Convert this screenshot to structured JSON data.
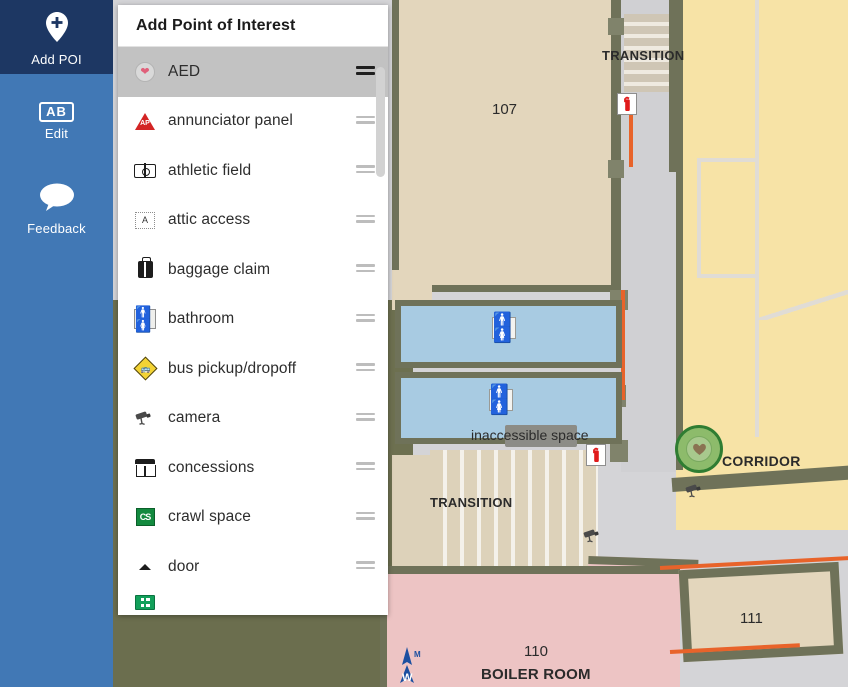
{
  "sidebar": {
    "items": [
      {
        "id": "add-poi",
        "label": "Add POI",
        "icon": "map-pin-plus-icon",
        "active": true
      },
      {
        "id": "edit",
        "label": "Edit",
        "icon": "ab-box-icon",
        "active": false
      },
      {
        "id": "feedback",
        "label": "Feedback",
        "icon": "speech-bubble-icon",
        "active": false
      }
    ],
    "active_color": "#1d3763",
    "background_color": "#4178b5"
  },
  "panel": {
    "title": "Add Point of Interest",
    "items": [
      {
        "label": "AED",
        "icon": "aed-heart-icon",
        "selected": true
      },
      {
        "label": "annunciator panel",
        "icon": "annunciator-panel-icon",
        "selected": false
      },
      {
        "label": "athletic field",
        "icon": "athletic-field-icon",
        "selected": false
      },
      {
        "label": "attic access",
        "icon": "attic-access-icon",
        "selected": false
      },
      {
        "label": "baggage claim",
        "icon": "baggage-claim-icon",
        "selected": false
      },
      {
        "label": "bathroom",
        "icon": "bathroom-icon",
        "selected": false
      },
      {
        "label": "bus pickup/dropoff",
        "icon": "bus-pickup-dropoff-icon",
        "selected": false
      },
      {
        "label": "camera",
        "icon": "camera-icon",
        "selected": false
      },
      {
        "label": "concessions",
        "icon": "concessions-icon",
        "selected": false
      },
      {
        "label": "crawl space",
        "icon": "crawl-space-icon",
        "selected": false
      },
      {
        "label": "door",
        "icon": "door-icon",
        "selected": false
      }
    ],
    "drag_handle": "drag-handle-icon"
  },
  "map": {
    "labels": {
      "room_107": "107",
      "transition_top": "TRANSITION",
      "inaccessible_space": "inaccessible space",
      "corridor": "CORRIDOR",
      "transition_bottom": "TRANSITION",
      "room_110": "110",
      "boiler_room": "BOILER ROOM",
      "room_111": "111"
    },
    "markers": {
      "aed_placed": "aed-marker",
      "fire_extinguisher": "fire-extinguisher-icon",
      "restroom": "restroom-icon",
      "camera": "security-camera-icon",
      "compass": "north-arrow-icon"
    },
    "colors": {
      "room_fill": "#e3d6bc",
      "bathroom_fill": "#a8cbe2",
      "corridor_fill": "#f7e3a6",
      "boiler_fill": "#edc4c4",
      "wall": "#6f7259",
      "path": "#e8632a",
      "grass": "#6d7050",
      "aed_marker": "#8dbb6b"
    }
  }
}
